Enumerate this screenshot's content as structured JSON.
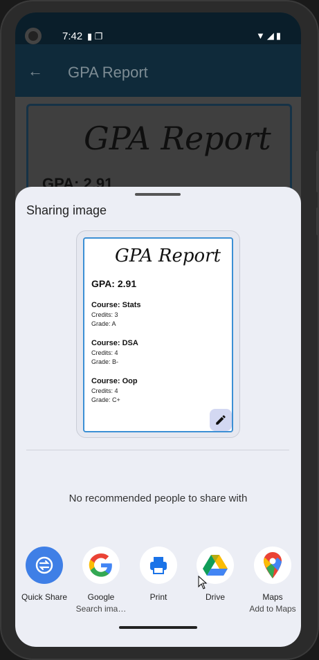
{
  "status": {
    "time": "7:42",
    "left_icons": "▮ ❐",
    "right_icons": "▼◢▮"
  },
  "appbar": {
    "title": "GPA Report"
  },
  "background": {
    "title": "GPA Report",
    "gpa": "GPA: 2.91"
  },
  "sheet": {
    "title": "Sharing image",
    "no_people": "No recommended people to share with"
  },
  "preview": {
    "title": "GPA Report",
    "gpa": "GPA: 2.91",
    "courses": [
      {
        "name": "Course: Stats",
        "credits": "Credits: 3",
        "grade": "Grade: A"
      },
      {
        "name": "Course: DSA",
        "credits": "Credits: 4",
        "grade": "Grade: B-"
      },
      {
        "name": "Course: Oop",
        "credits": "Credits: 4",
        "grade": "Grade: C+"
      }
    ]
  },
  "apps": [
    {
      "label": "Quick Share",
      "sub": "",
      "icon": "quick-share-icon"
    },
    {
      "label": "Google",
      "sub": "Search ima…",
      "icon": "google-icon"
    },
    {
      "label": "Print",
      "sub": "",
      "icon": "printer-icon"
    },
    {
      "label": "Drive",
      "sub": "",
      "icon": "drive-icon"
    },
    {
      "label": "Maps",
      "sub": "Add to Maps",
      "icon": "maps-icon"
    }
  ],
  "colors": {
    "accent": "#3b8fd4",
    "quick_share": "#3f7fe6",
    "sheet_bg": "#eceef5"
  }
}
